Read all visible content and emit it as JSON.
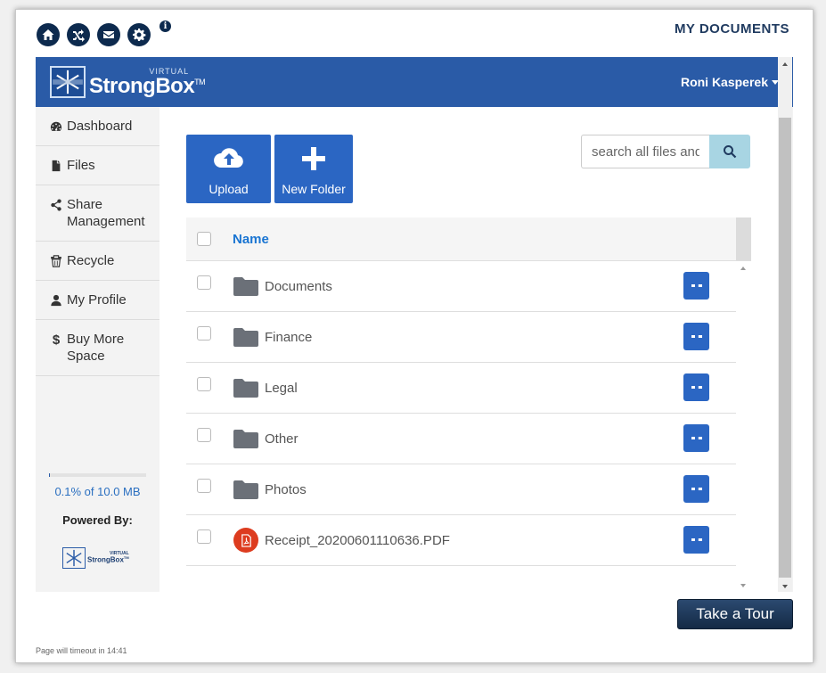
{
  "header": {
    "page_title": "MY DOCUMENTS",
    "icons": [
      "home-icon",
      "shuffle-icon",
      "mail-icon",
      "gear-icon",
      "info-icon"
    ],
    "info_glyph": "i"
  },
  "navbar": {
    "logo_small": "VIRTUAL",
    "logo_big": "StrongBox",
    "logo_tm": "TM",
    "user_name": "Roni Kasperek",
    "color": "#2a5ba7"
  },
  "sidebar": {
    "items": [
      {
        "label": "Dashboard",
        "icon": "dashboard-icon"
      },
      {
        "label": "Files",
        "icon": "file-icon"
      },
      {
        "label": "Share Management",
        "icon": "share-icon"
      },
      {
        "label": "Recycle",
        "icon": "trash-icon"
      },
      {
        "label": "My Profile",
        "icon": "user-icon"
      },
      {
        "label": "Buy More Space",
        "icon": "dollar-icon",
        "glyph": "$"
      }
    ],
    "storage_text": "0.1% of 10.0 MB",
    "storage_percent": 0.1,
    "powered_by": "Powered By:",
    "mini_logo_small": "VIRTUAL",
    "mini_logo_big": "StrongBox",
    "mini_logo_tm": "TM"
  },
  "toolbar": {
    "upload_label": "Upload",
    "new_folder_label": "New Folder",
    "search_placeholder": "search all files and folders"
  },
  "table": {
    "header_name": "Name",
    "rows": [
      {
        "name": "Documents",
        "type": "folder"
      },
      {
        "name": "Finance",
        "type": "folder"
      },
      {
        "name": "Legal",
        "type": "folder"
      },
      {
        "name": "Other",
        "type": "folder"
      },
      {
        "name": "Photos",
        "type": "folder"
      },
      {
        "name": "Receipt_20200601110636.PDF",
        "type": "pdf"
      }
    ]
  },
  "footer": {
    "tour_label": "Take a Tour",
    "timeout_text": "Page will timeout in 14:41"
  },
  "colors": {
    "accent": "#2b66c3",
    "dark_navy": "#0d2a4e",
    "pdf_red": "#dd3c1f",
    "folder_gray": "#6b7078"
  }
}
